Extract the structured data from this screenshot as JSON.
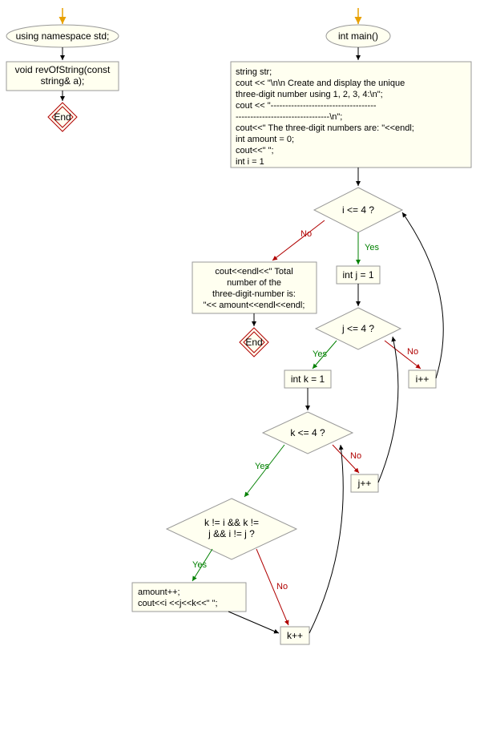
{
  "left_branch": {
    "namespace": "using namespace std;",
    "func_decl": [
      "void revOfString(const",
      "string& a);"
    ],
    "end": "End"
  },
  "main_branch": {
    "main_call": "int main()",
    "init_block": [
      "string str;",
      "cout << \"\\n\\n Create and display the unique",
      "three-digit number using 1, 2, 3, 4:\\n\";",
      "cout << \"------------------------------------",
      "--------------------------------\\n\";",
      "cout<<\" The three-digit numbers are: \"<<endl;",
      "int amount = 0;",
      "cout<<\" \";",
      "int i = 1"
    ],
    "cond_i": "i <= 4 ?",
    "total_block": [
      "cout<<endl<<\" Total",
      "number of the",
      "three-digit-number is:",
      "\"<< amount<<endl<<endl;"
    ],
    "end": "End",
    "init_j": "int j = 1",
    "cond_j": "j <= 4 ?",
    "init_k": "int k = 1",
    "inc_i": "i++",
    "cond_k": "k <= 4 ?",
    "inc_j": "j++",
    "cond_diff": [
      "k != i && k !=",
      "j && i != j ?"
    ],
    "print_block": [
      "amount++;",
      "cout<<i <<j<<k<<\" \";"
    ],
    "inc_k": "k++"
  },
  "labels": {
    "yes": "Yes",
    "no": "No"
  }
}
